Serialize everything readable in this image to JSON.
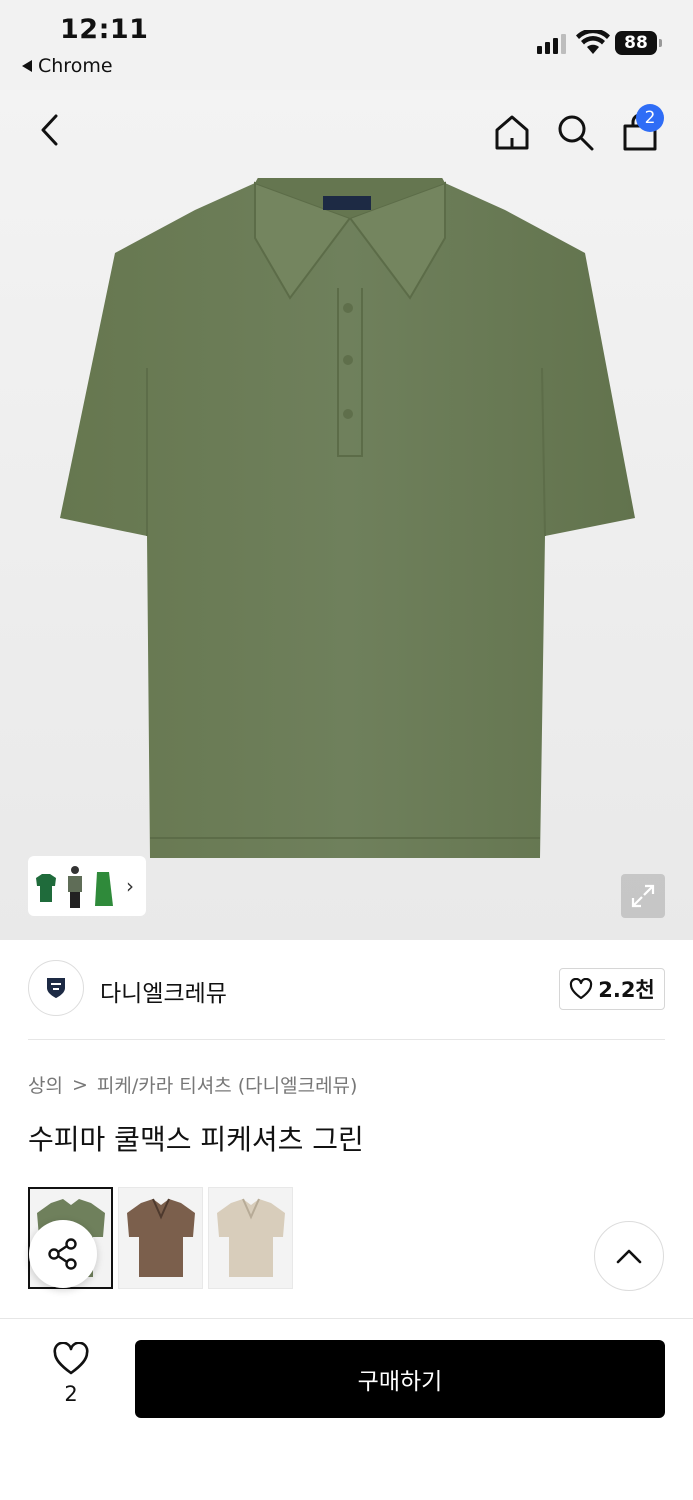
{
  "status_bar": {
    "time": "12:11",
    "back_app": "Chrome",
    "battery": "88",
    "signal_bars_active": 3,
    "signal_bars_total": 4
  },
  "nav": {
    "back_icon": "chevron-left-icon",
    "home_icon": "home-icon",
    "search_icon": "search-icon",
    "cart_icon": "shopping-bag-icon",
    "cart_badge": "2"
  },
  "product_image": {
    "shirt_color": "#6f805c",
    "thumbnail_chevron": "›",
    "expand_icon": "expand-icon"
  },
  "brand": {
    "name": "다니엘크레뮤",
    "likes": "2.2천"
  },
  "breadcrumb": {
    "category": "상의",
    "separator": ">",
    "subcategory": "피케/카라 티셔츠 (다니엘크레뮤)"
  },
  "product": {
    "title": "수피마 쿨맥스 피케셔츠 그린"
  },
  "variants": [
    {
      "color": "#6f805c",
      "selected": true
    },
    {
      "color": "#7b5f4c",
      "selected": false
    },
    {
      "color": "#d8cdbb",
      "selected": false
    }
  ],
  "bottom_bar": {
    "wish_count": "2",
    "buy_label": "구매하기"
  },
  "colors": {
    "badge": "#2f6df6",
    "buy_button": "#000000"
  }
}
